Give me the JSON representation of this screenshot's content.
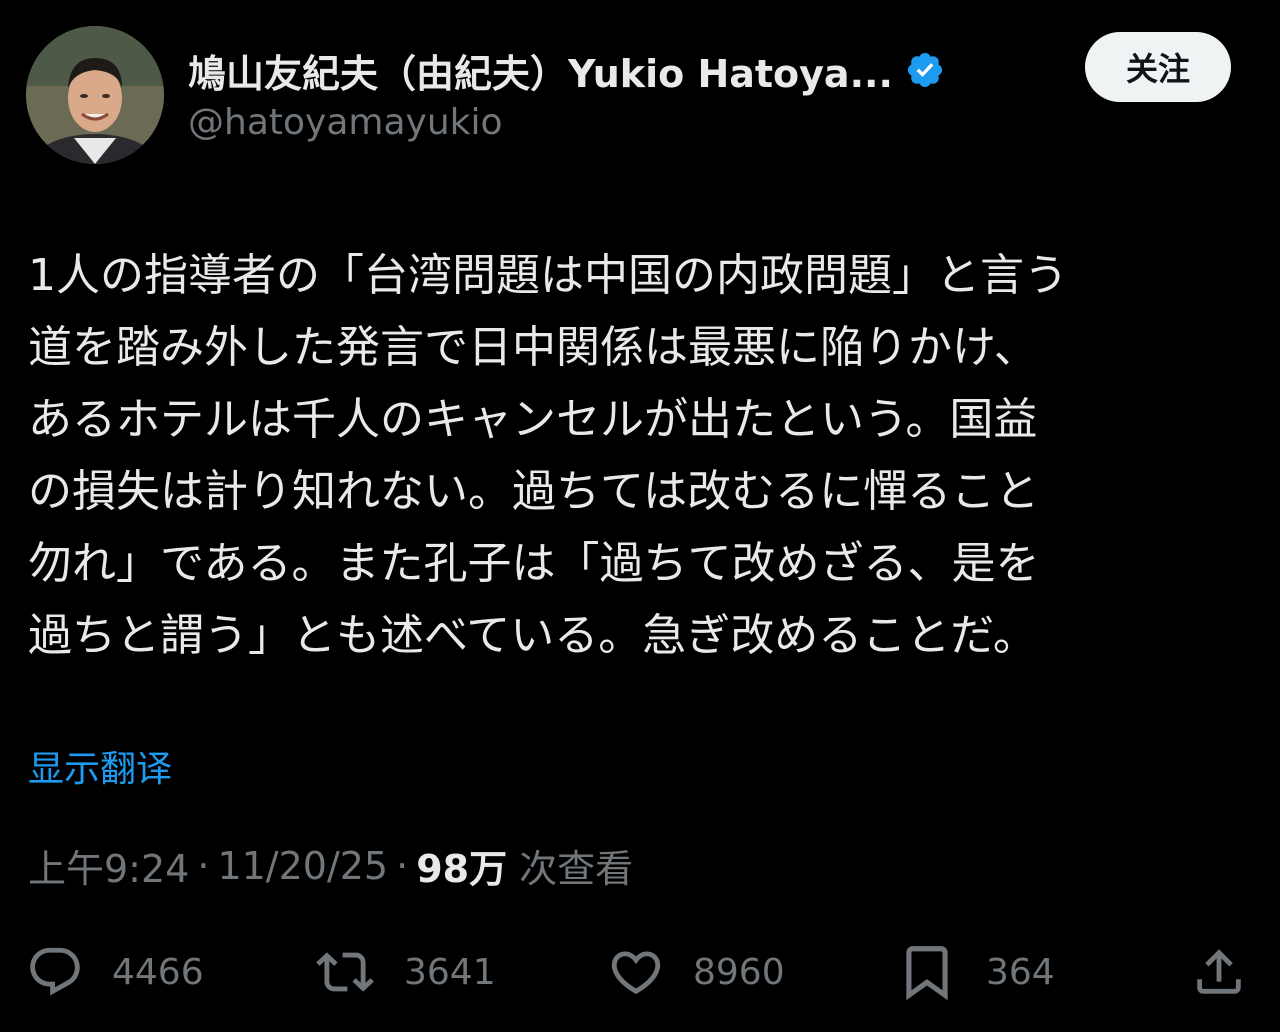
{
  "author": {
    "display_name": "鳩山友紀夫（由紀夫）Yukio Hatoya...",
    "handle": "@hatoyamayukio",
    "verified_icon": "verified-badge-icon",
    "avatar": "avatar-photo"
  },
  "follow_button": {
    "label": "关注"
  },
  "tweet": {
    "lines": [
      "1人の指導者の「台湾問題は中国の内政問題」と言う",
      "道を踏み外した発言で日中関係は最悪に陥りかけ、",
      "あるホテルは千人のキャンセルが出たという。国益",
      "の損失は計り知れない。過ちては改むるに憚ること",
      "勿れ」である。また孔子は「過ちて改めざる、是を",
      "過ちと謂う」とも述べている。急ぎ改めることだ。"
    ]
  },
  "translate_link": "显示翻译",
  "meta": {
    "time": "上午9:24",
    "separator": "·",
    "date": "11/20/25",
    "views_count": "98万",
    "views_label": "次查看"
  },
  "actions": {
    "reply": {
      "icon": "reply-icon",
      "count": "4466"
    },
    "retweet": {
      "icon": "retweet-icon",
      "count": "3641"
    },
    "like": {
      "icon": "like-icon",
      "count": "8960"
    },
    "bookmark": {
      "icon": "bookmark-icon",
      "count": "364"
    },
    "share": {
      "icon": "share-icon"
    }
  },
  "colors": {
    "background": "#000000",
    "text_primary": "#e7e9ea",
    "text_secondary": "#71767b",
    "accent": "#1d9bf0",
    "follow_button_bg": "#eff3f4"
  }
}
